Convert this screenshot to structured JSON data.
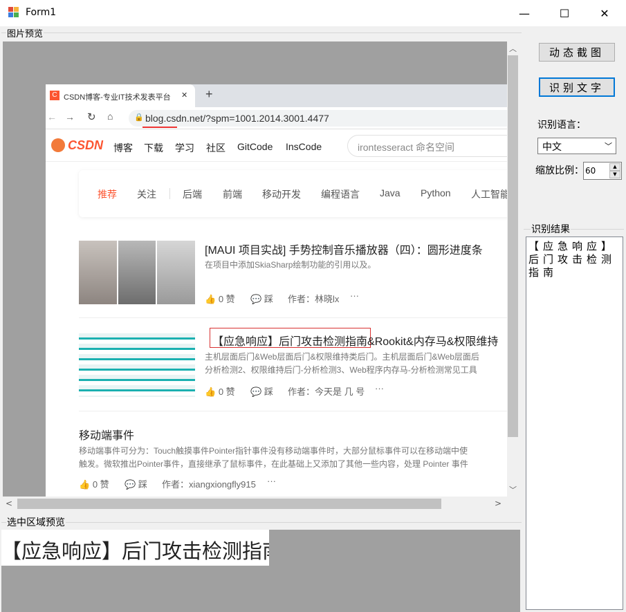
{
  "window": {
    "title": "Form1",
    "minimize": "—",
    "maximize": "☐",
    "close": "✕"
  },
  "preview_group": {
    "label": "图片预览"
  },
  "browser": {
    "tab_title": "CSDN博客-专业IT技术发表平台",
    "tab_close": "✕",
    "new_tab": "+",
    "url": "blog.csdn.net/?spm=1001.2014.3001.4477",
    "logo_text": "CSDN",
    "nav": [
      "博客",
      "下载",
      "学习",
      "社区",
      "GitCode",
      "InsCode"
    ],
    "search_placeholder": "irontesseract 命名空间",
    "channels": [
      "推荐",
      "关注",
      "后端",
      "前端",
      "移动开发",
      "编程语言",
      "Java",
      "Python",
      "人工智能"
    ],
    "articles": [
      {
        "title": "[MAUI 项目实战] 手势控制音乐播放器（四）：圆形进度条",
        "desc": "在项目中添加SkiaSharp绘制功能的引用以及。",
        "like": "0 赞",
        "dislike": "踩",
        "author": "作者：林晓lx",
        "more": "···"
      },
      {
        "title_highlight": "【应急响应】后门攻击检测指南",
        "title_rest": "&Rookit&内存马&权限维持",
        "desc1": "主机层面后门&Web层面后门&权限维持类后门。主机层面后门&Web层面后",
        "desc2": "分析检测2、权限维持后门-分析检测3、Web程序内存马-分析检测常见工具",
        "like": "0 赞",
        "dislike": "踩",
        "author": "作者：今天是 几 号",
        "more": "···"
      },
      {
        "title": "移动端事件",
        "desc1": "移动端事件可分为：Touch触摸事件Pointer指针事件没有移动端事件时，大部分鼠标事件可以在移动端中使",
        "desc2": "触发。微软推出Pointer事件，直接继承了鼠标事件，在此基础上又添加了其他一些内容，处理 Pointer 事件",
        "like": "0 赞",
        "dislike": "踩",
        "author": "作者：xiangxiongfly915",
        "more": "···"
      }
    ]
  },
  "right_panel": {
    "capture_button": "动态截图",
    "ocr_button": "识别文字",
    "lang_label": "识别语言：",
    "lang_value": "中文",
    "scale_label": "缩放比例：",
    "scale_value": "60",
    "result_label": "识别结果",
    "result_text": "【应急响应】后门攻击检测指南"
  },
  "selection_group": {
    "label": "选中区域预览",
    "preview_text": "【应急响应】后门攻击检测指南&"
  }
}
